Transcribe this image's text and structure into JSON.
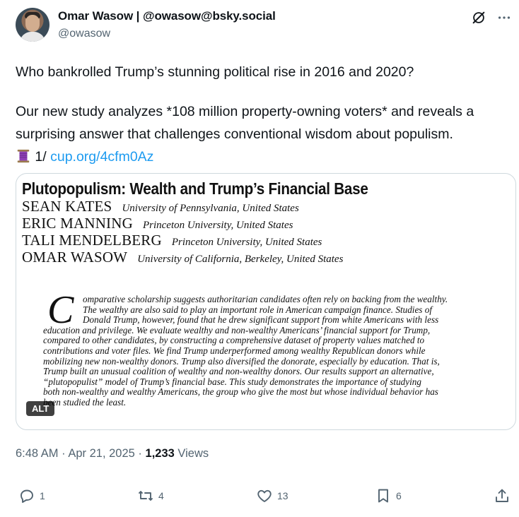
{
  "author": {
    "display_name": "Omar Wasow | @owasow@bsky.social",
    "handle": "@owasow"
  },
  "icons": {
    "grok": "grok-icon",
    "more": "more-icon",
    "reply": "reply-icon",
    "repost": "repost-icon",
    "like": "heart-icon",
    "bookmark": "bookmark-icon",
    "share": "share-icon",
    "thread": "spool-emoji"
  },
  "tweet": {
    "line1": "Who bankrolled Trump’s stunning political rise in 2016 and 2020?",
    "line2": "Our new study analyzes *108 million property-owning voters* and reveals a surprising answer that challenges conventional wisdom about populism.",
    "thread_marker": "1/",
    "link_text": "cup.org/4cfm0Az"
  },
  "paper": {
    "title": "Plutopopulism: Wealth and Trump’s Financial Base",
    "authors": [
      {
        "name": "SEAN KATES",
        "affiliation": "University of Pennsylvania, United States"
      },
      {
        "name": "ERIC MANNING",
        "affiliation": "Princeton University, United States"
      },
      {
        "name": "TALI MENDELBERG",
        "affiliation": "Princeton University, United States"
      },
      {
        "name": "OMAR WASOW",
        "affiliation": "University of California, Berkeley, United States"
      }
    ],
    "dropcap": "C",
    "abstract_lines": [
      "omparative scholarship suggests authoritarian candidates often rely on backing from the wealthy.",
      "The wealthy are also said to play an important role in American campaign finance. Studies of",
      "Donald Trump, however, found that he drew significant support from white Americans with less",
      "education and privilege. We evaluate wealthy and non-wealthy Americans’ financial support for Trump,",
      "compared to other candidates, by constructing a comprehensive dataset of property values matched to",
      "contributions and voter files. We find Trump underperformed among wealthy Republican donors while",
      "mobilizing new non-wealthy donors. Trump also diversified the donorate, especially by education. That is,",
      "Trump built an unusual coalition of wealthy and non-wealthy donors. Our results support an alternative,",
      "“plutopopulist” model of Trump’s financial base. This study demonstrates the importance of studying",
      "both non-wealthy and wealthy Americans, the group who give the most but whose individual behavior has",
      "been studied the least."
    ],
    "alt_label": "ALT"
  },
  "meta": {
    "time": "6:48 AM",
    "sep1": "·",
    "date": "Apr 21, 2025",
    "sep2": "·",
    "views_count": "1,233",
    "views_label": "Views"
  },
  "actions": {
    "replies": "1",
    "reposts": "4",
    "likes": "13",
    "bookmarks": "6"
  }
}
